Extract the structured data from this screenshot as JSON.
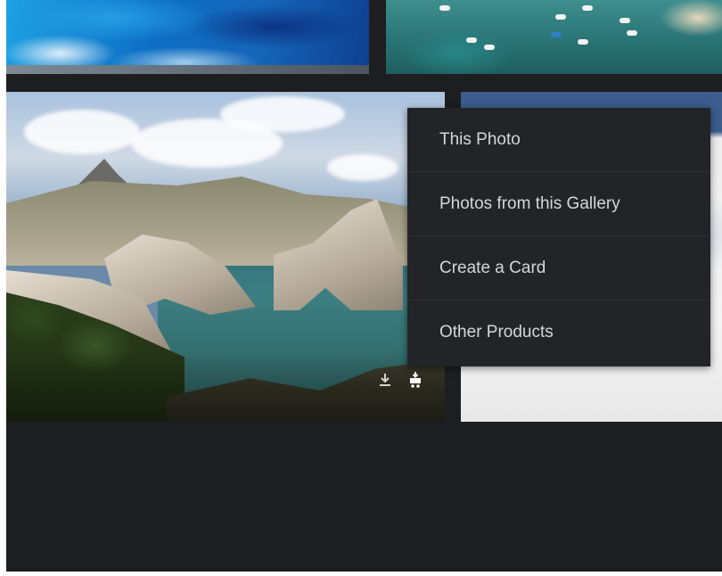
{
  "gallery": {
    "photos": [
      {
        "name": "ocean-waves"
      },
      {
        "name": "harbor-boats"
      },
      {
        "name": "coastal-cliffs"
      },
      {
        "name": "white-rocks"
      }
    ],
    "actions": {
      "download_icon": "download-icon",
      "cart_icon": "cart-icon"
    }
  },
  "context_menu": {
    "items": [
      {
        "label": "This Photo"
      },
      {
        "label": "Photos from this Gallery"
      },
      {
        "label": "Create a Card"
      },
      {
        "label": "Other Products"
      }
    ]
  },
  "colors": {
    "page_background": "#1d1e20",
    "menu_background": "#232427",
    "menu_text": "#d6d6d6"
  }
}
